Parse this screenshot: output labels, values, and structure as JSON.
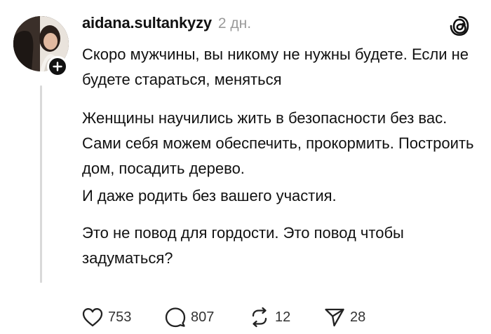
{
  "post": {
    "author": {
      "username": "aidana.sultankyzy",
      "avatar_icon": "avatar-photo"
    },
    "timestamp": "2 дн.",
    "paragraphs": [
      "Скоро мужчины, вы никому не нужны будете. Если не будете стараться, меняться",
      "Женщины научились жить в безопасности без вас. Сами себя можем обеспечить, прокормить. Построить дом, посадить дерево.",
      "И даже родить без вашего участия.",
      "Это не повод для гордости. Это повод чтобы задуматься?"
    ],
    "actions": {
      "likes": "753",
      "comments": "807",
      "reposts": "12",
      "shares": "28"
    },
    "icons": {
      "brand": "threads-logo-icon",
      "follow": "plus-icon",
      "like": "heart-icon",
      "comment": "speech-bubble-icon",
      "repost": "repost-arrows-icon",
      "share": "paper-plane-icon"
    },
    "colors": {
      "text": "#111111",
      "muted": "#9a9a9a",
      "thread_line": "#d9d9d9"
    }
  }
}
